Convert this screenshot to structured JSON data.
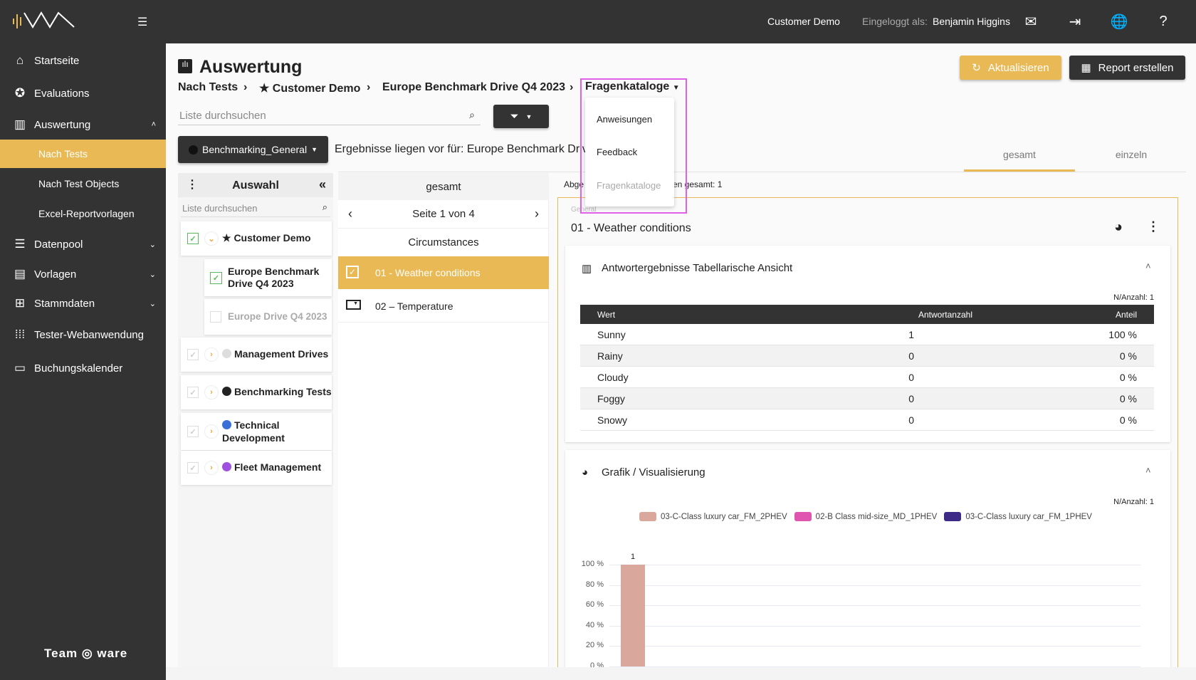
{
  "topbar": {
    "tenant": "Customer Demo",
    "logged_in_label": "Eingeloggt als:",
    "user": "Benjamin Higgins",
    "icons": [
      "mail-icon",
      "logout-icon",
      "globe-icon",
      "help-icon"
    ]
  },
  "sidebar": {
    "items": [
      {
        "label": "Startseite",
        "icon": "home-icon"
      },
      {
        "label": "Evaluations",
        "icon": "star-circle-icon"
      },
      {
        "label": "Auswertung",
        "icon": "chart-icon",
        "expanded": true
      },
      {
        "label": "Datenpool",
        "icon": "list-icon"
      },
      {
        "label": "Vorlagen",
        "icon": "template-icon"
      },
      {
        "label": "Stammdaten",
        "icon": "hierarchy-icon"
      },
      {
        "label": "Tester-Webanwendung",
        "icon": "grid-icon"
      },
      {
        "label": "Buchungskalender",
        "icon": "calendar-icon"
      }
    ],
    "subitems": [
      {
        "label": "Nach Tests",
        "active": true
      },
      {
        "label": "Nach Test Objects"
      },
      {
        "label": "Excel-Reportvorlagen"
      }
    ],
    "footer_logo": "Teamware Solutions"
  },
  "page": {
    "title": "Auswertung",
    "breadcrumb": [
      "Nach Tests",
      "★ Customer Demo",
      "Europe Benchmark Drive Q4 2023",
      "Fragenkataloge"
    ],
    "refresh_label": "Aktualisieren",
    "report_label": "Report erstellen",
    "search_placeholder": "Liste durchsuchen",
    "group_select": "Benchmarking_General",
    "results_text": "Ergebnisse liegen vor für: Europe Benchmark Driv",
    "tabs": [
      "gesamt",
      "einzeln"
    ],
    "active_tab": "gesamt",
    "accent": "#e9b955"
  },
  "dropdown": {
    "items": [
      "Anweisungen",
      "Feedback",
      "Fragenkataloge"
    ],
    "selected": "Fragenkataloge"
  },
  "selection": {
    "title": "Auswahl",
    "search_placeholder": "Liste durchsuchen",
    "items": [
      {
        "label": "★ Customer Demo",
        "checked": true,
        "expanded": true
      },
      {
        "label": "Europe Benchmark Drive Q4 2023",
        "checked": true,
        "child": true
      },
      {
        "label": "Europe Drive Q4 2023",
        "checked": false,
        "child": true
      },
      {
        "label": "Management Drives",
        "dot": "#dddddd"
      },
      {
        "label": "Benchmarking Tests",
        "dot": "#222222"
      },
      {
        "label": "Technical Development",
        "dot": "#3a6fd8"
      },
      {
        "label": "Fleet Management",
        "dot": "#a050e0"
      }
    ]
  },
  "questions": {
    "header": "gesamt",
    "pager": "Seite 1 von 4",
    "section": "Circumstances",
    "items": [
      {
        "label": "01 - Weather conditions",
        "active": true
      },
      {
        "label": "02 – Temperature"
      }
    ]
  },
  "result": {
    "summary_left": "Abge",
    "summary_right": "en gesamt: 1",
    "category": "General",
    "question": "01 - Weather conditions",
    "table_title": "Antwortergebnisse Tabellarische Ansicht",
    "n_label": "N/Anzahl: 1",
    "columns": [
      "Wert",
      "Antwortanzahl",
      "Anteil"
    ],
    "rows": [
      [
        "Sunny",
        "1",
        "100 %"
      ],
      [
        "Rainy",
        "0",
        "0 %"
      ],
      [
        "Cloudy",
        "0",
        "0 %"
      ],
      [
        "Foggy",
        "0",
        "0 %"
      ],
      [
        "Snowy",
        "0",
        "0 %"
      ]
    ],
    "chart_title": "Grafik / Visualisierung"
  },
  "chart_data": {
    "type": "bar",
    "legend": [
      {
        "name": "03-C-Class luxury car_FM_2PHEV",
        "color": "#d9a79c"
      },
      {
        "name": "02-B Class mid-size_MD_1PHEV",
        "color": "#e055b0"
      },
      {
        "name": "03-C-Class luxury car_FM_1PHEV",
        "color": "#3c2a86"
      }
    ],
    "legend_position": "top",
    "yticks": [
      "100 %",
      "80 %",
      "60 %",
      "40 %",
      "20 %",
      "0 %"
    ],
    "ylim": [
      0,
      100
    ],
    "bars": [
      {
        "series": "03-C-Class luxury car_FM_2PHEV",
        "value": 100,
        "label": "1"
      }
    ],
    "grid": true
  }
}
